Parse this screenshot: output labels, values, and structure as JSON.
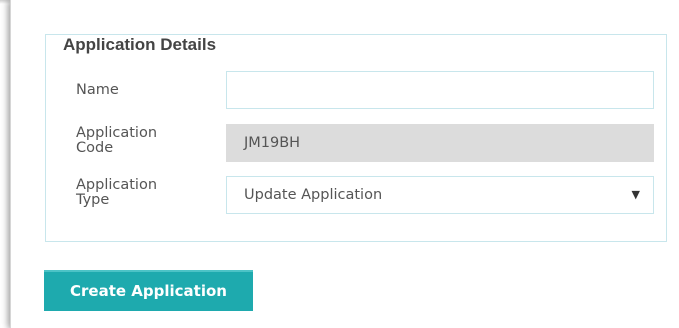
{
  "form": {
    "section_title": "Application Details",
    "name": {
      "label": "Name",
      "value": "",
      "placeholder": ""
    },
    "code": {
      "label_line1": "Application",
      "label_line2": "Code",
      "value": "JM19BH"
    },
    "type": {
      "label_line1": "Application",
      "label_line2": "Type",
      "selected": "Update Application"
    }
  },
  "actions": {
    "create_label": "Create Application"
  },
  "colors": {
    "accent": "#1eaaae",
    "border": "#c8e6ec",
    "readonly_bg": "#dcdcdc"
  }
}
